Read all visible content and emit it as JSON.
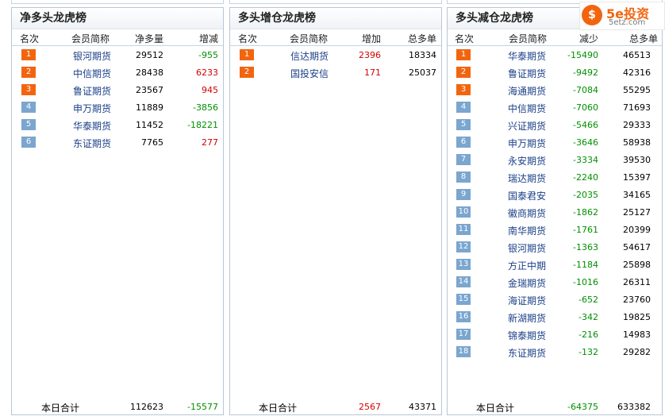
{
  "logo": {
    "mark": "$",
    "main": "5e投资",
    "sub": "5etz.com"
  },
  "panels": [
    {
      "title": "净多头龙虎榜",
      "headers": [
        "名次",
        "会员简称",
        "净多量",
        "增减"
      ],
      "rows": [
        {
          "rank": "1",
          "name": "银河期货",
          "v1": "29512",
          "v2": "-955",
          "dir": "down"
        },
        {
          "rank": "2",
          "name": "中信期货",
          "v1": "28438",
          "v2": "6233",
          "dir": "up"
        },
        {
          "rank": "3",
          "name": "鲁证期货",
          "v1": "23567",
          "v2": "945",
          "dir": "up"
        },
        {
          "rank": "4",
          "name": "申万期货",
          "v1": "11889",
          "v2": "-3856",
          "dir": "down"
        },
        {
          "rank": "5",
          "name": "华泰期货",
          "v1": "11452",
          "v2": "-18221",
          "dir": "down"
        },
        {
          "rank": "6",
          "name": "东证期货",
          "v1": "7765",
          "v2": "277",
          "dir": "up"
        }
      ],
      "total": {
        "label": "本日合计",
        "v1": "112623",
        "v2": "-15577",
        "dir": "down"
      }
    },
    {
      "title": "多头增仓龙虎榜",
      "headers": [
        "名次",
        "会员简称",
        "增加",
        "总多单"
      ],
      "rows": [
        {
          "rank": "1",
          "name": "信达期货",
          "v1": "2396",
          "v2": "18334",
          "dir": "up"
        },
        {
          "rank": "2",
          "name": "国投安信",
          "v1": "171",
          "v2": "25037",
          "dir": "up"
        }
      ],
      "total": {
        "label": "本日合计",
        "v1": "2567",
        "v2": "43371",
        "dir": "up"
      }
    },
    {
      "title": "多头减仓龙虎榜",
      "headers": [
        "名次",
        "会员简称",
        "减少",
        "总多单"
      ],
      "rows": [
        {
          "rank": "1",
          "name": "华泰期货",
          "v1": "-15490",
          "v2": "46513",
          "dir": "down"
        },
        {
          "rank": "2",
          "name": "鲁证期货",
          "v1": "-9492",
          "v2": "42316",
          "dir": "down"
        },
        {
          "rank": "3",
          "name": "海通期货",
          "v1": "-7084",
          "v2": "55295",
          "dir": "down"
        },
        {
          "rank": "4",
          "name": "中信期货",
          "v1": "-7060",
          "v2": "71693",
          "dir": "down"
        },
        {
          "rank": "5",
          "name": "兴证期货",
          "v1": "-5466",
          "v2": "29333",
          "dir": "down"
        },
        {
          "rank": "6",
          "name": "申万期货",
          "v1": "-3646",
          "v2": "58938",
          "dir": "down"
        },
        {
          "rank": "7",
          "name": "永安期货",
          "v1": "-3334",
          "v2": "39530",
          "dir": "down"
        },
        {
          "rank": "8",
          "name": "瑞达期货",
          "v1": "-2240",
          "v2": "15397",
          "dir": "down"
        },
        {
          "rank": "9",
          "name": "国泰君安",
          "v1": "-2035",
          "v2": "34165",
          "dir": "down"
        },
        {
          "rank": "10",
          "name": "徽商期货",
          "v1": "-1862",
          "v2": "25127",
          "dir": "down"
        },
        {
          "rank": "11",
          "name": "南华期货",
          "v1": "-1761",
          "v2": "20399",
          "dir": "down"
        },
        {
          "rank": "12",
          "name": "银河期货",
          "v1": "-1363",
          "v2": "54617",
          "dir": "down"
        },
        {
          "rank": "13",
          "name": "方正中期",
          "v1": "-1184",
          "v2": "25898",
          "dir": "down"
        },
        {
          "rank": "14",
          "name": "金瑞期货",
          "v1": "-1016",
          "v2": "26311",
          "dir": "down"
        },
        {
          "rank": "15",
          "name": "海证期货",
          "v1": "-652",
          "v2": "23760",
          "dir": "down"
        },
        {
          "rank": "16",
          "name": "新湖期货",
          "v1": "-342",
          "v2": "19825",
          "dir": "down"
        },
        {
          "rank": "17",
          "name": "锦泰期货",
          "v1": "-216",
          "v2": "14983",
          "dir": "down"
        },
        {
          "rank": "18",
          "name": "东证期货",
          "v1": "-132",
          "v2": "29282",
          "dir": "down"
        }
      ],
      "total": {
        "label": "本日合计",
        "v1": "-64375",
        "v2": "633382",
        "dir": "down"
      }
    }
  ],
  "colors": {
    "up": "#d40000",
    "down": "#009000",
    "rank_top": "#f2650f",
    "rank_rest": "#7aa6cf",
    "name": "#1b3f88"
  }
}
